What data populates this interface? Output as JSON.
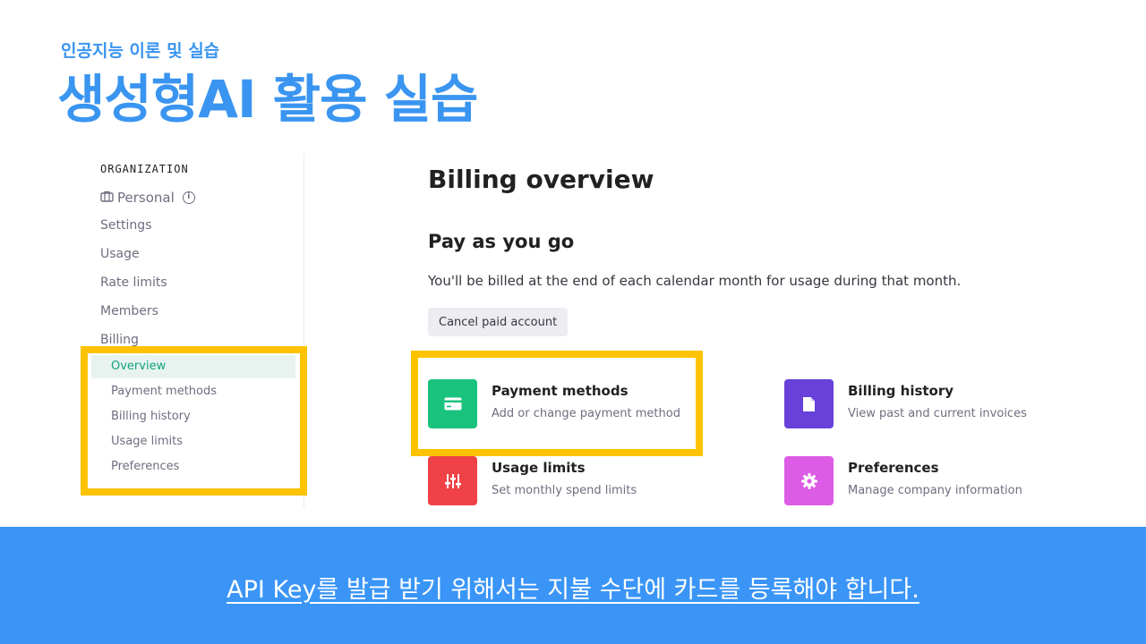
{
  "slide": {
    "subtitle": "인공지능 이론 및 실습",
    "title": "생성형AI 활용 실습"
  },
  "sidebar": {
    "org_label": "ORGANIZATION",
    "org_name": "Personal",
    "items": [
      "Settings",
      "Usage",
      "Rate limits",
      "Members",
      "Billing"
    ],
    "billing_sub": [
      "Overview",
      "Payment methods",
      "Billing history",
      "Usage limits",
      "Preferences"
    ],
    "active_sub": "Overview"
  },
  "main": {
    "heading": "Billing overview",
    "section": "Pay as you go",
    "description": "You'll be billed at the end of each calendar month for usage during that month.",
    "cancel_label": "Cancel paid account",
    "cards": [
      {
        "title": "Payment methods",
        "desc": "Add or change payment method",
        "color": "#19c37d",
        "icon": "credit-card-icon"
      },
      {
        "title": "Billing history",
        "desc": "View past and current invoices",
        "color": "#6741d9",
        "icon": "document-icon"
      },
      {
        "title": "Usage limits",
        "desc": "Set monthly spend limits",
        "color": "#ef4146",
        "icon": "sliders-icon"
      },
      {
        "title": "Preferences",
        "desc": "Manage company information",
        "color": "#dd5ce5",
        "icon": "gear-icon"
      }
    ]
  },
  "banner": {
    "text": "API Key를 발급 받기 위해서는 지불 수단에 카드를 등록해야 합니다."
  },
  "colors": {
    "accent": "#3a95f0",
    "highlight": "#fdc300",
    "active_green": "#10a37f"
  }
}
